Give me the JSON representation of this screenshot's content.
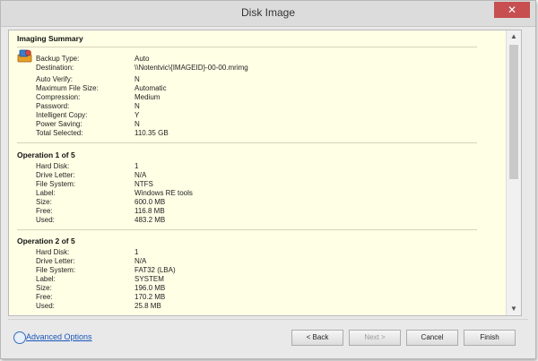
{
  "window": {
    "title": "Disk Image",
    "close_glyph": "✕"
  },
  "icons": {
    "app": "disk-image-icon",
    "advanced": "advanced-options-icon"
  },
  "summary": {
    "title": "Imaging Summary",
    "rows": [
      {
        "label": "Backup Type:",
        "value": "Auto"
      },
      {
        "label": "Destination:",
        "value": "\\\\Notentvic\\{IMAGEID}-00-00.mrimg"
      },
      {
        "label": "Auto Verify:",
        "value": "N"
      },
      {
        "label": "Maximum File Size:",
        "value": "Automatic"
      },
      {
        "label": "Compression:",
        "value": "Medium"
      },
      {
        "label": "Password:",
        "value": "N"
      },
      {
        "label": "Intelligent Copy:",
        "value": "Y"
      },
      {
        "label": "Power Saving:",
        "value": "N"
      },
      {
        "label": "Total Selected:",
        "value": "110.35 GB"
      }
    ]
  },
  "operations": [
    {
      "title": "Operation 1 of 5",
      "rows": [
        {
          "label": "Hard Disk:",
          "value": "1"
        },
        {
          "label": "Drive Letter:",
          "value": "N/A"
        },
        {
          "label": "File System:",
          "value": "NTFS"
        },
        {
          "label": "Label:",
          "value": "Windows RE tools"
        },
        {
          "label": "Size:",
          "value": "600.0 MB"
        },
        {
          "label": "Free:",
          "value": "116.8 MB"
        },
        {
          "label": "Used:",
          "value": "483.2 MB"
        }
      ]
    },
    {
      "title": "Operation 2 of 5",
      "rows": [
        {
          "label": "Hard Disk:",
          "value": "1"
        },
        {
          "label": "Drive Letter:",
          "value": "N/A"
        },
        {
          "label": "File System:",
          "value": "FAT32 (LBA)"
        },
        {
          "label": "Label:",
          "value": "SYSTEM"
        },
        {
          "label": "Size:",
          "value": "196.0 MB"
        },
        {
          "label": "Free:",
          "value": "170.2 MB"
        },
        {
          "label": "Used:",
          "value": "25.8 MB"
        }
      ]
    }
  ],
  "footer": {
    "advanced_options": "Advanced Options",
    "back": "< Back",
    "next": "Next >",
    "cancel": "Cancel",
    "finish": "Finish"
  }
}
